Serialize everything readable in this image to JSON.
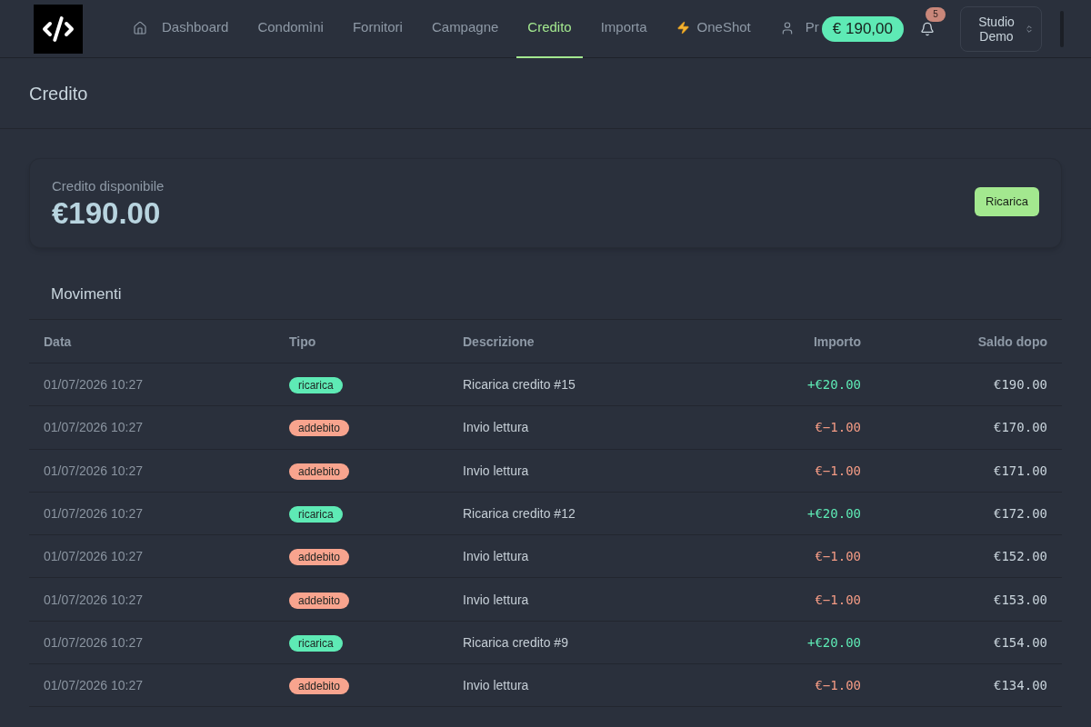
{
  "header": {
    "nav": [
      {
        "label": "Dashboard",
        "selected": false
      },
      {
        "label": "Condomìni",
        "selected": false
      },
      {
        "label": "Fornitori",
        "selected": false
      },
      {
        "label": "Campagne",
        "selected": false
      },
      {
        "label": "Credito",
        "selected": true
      },
      {
        "label": "Importa",
        "selected": false
      },
      {
        "label": "OneShot",
        "selected": false
      },
      {
        "label": "Pr",
        "selected": false
      }
    ],
    "balance": "€ 190,00",
    "notifications": "5",
    "account": "Studio Demo"
  },
  "page": {
    "title": "Credito"
  },
  "credit_card": {
    "label": "Credito disponibile",
    "amount": "€190.00",
    "button": "Ricarica"
  },
  "movements": {
    "title": "Movimenti",
    "columns": [
      "Data",
      "Tipo",
      "Descrizione",
      "Importo",
      "Saldo dopo"
    ],
    "rows": [
      {
        "kind": "credit",
        "date": "01/07/2026 10:27",
        "type": "ricarica",
        "description": "Ricarica credito #15",
        "amount": "+€20.00",
        "balance": "€190.00"
      },
      {
        "kind": "debit",
        "date": "01/07/2026 10:27",
        "type": "addebito",
        "description": "Invio lettura",
        "amount": "€−1.00",
        "balance": "€170.00"
      },
      {
        "kind": "debit",
        "date": "01/07/2026 10:27",
        "type": "addebito",
        "description": "Invio lettura",
        "amount": "€−1.00",
        "balance": "€171.00"
      },
      {
        "kind": "credit",
        "date": "01/07/2026 10:27",
        "type": "ricarica",
        "description": "Ricarica credito #12",
        "amount": "+€20.00",
        "balance": "€172.00"
      },
      {
        "kind": "debit",
        "date": "01/07/2026 10:27",
        "type": "addebito",
        "description": "Invio lettura",
        "amount": "€−1.00",
        "balance": "€152.00"
      },
      {
        "kind": "debit",
        "date": "01/07/2026 10:27",
        "type": "addebito",
        "description": "Invio lettura",
        "amount": "€−1.00",
        "balance": "€153.00"
      },
      {
        "kind": "credit",
        "date": "01/07/2026 10:27",
        "type": "ricarica",
        "description": "Ricarica credito #9",
        "amount": "+€20.00",
        "balance": "€154.00"
      },
      {
        "kind": "debit",
        "date": "01/07/2026 10:27",
        "type": "addebito",
        "description": "Invio lettura",
        "amount": "€−1.00",
        "balance": "€134.00"
      }
    ]
  }
}
